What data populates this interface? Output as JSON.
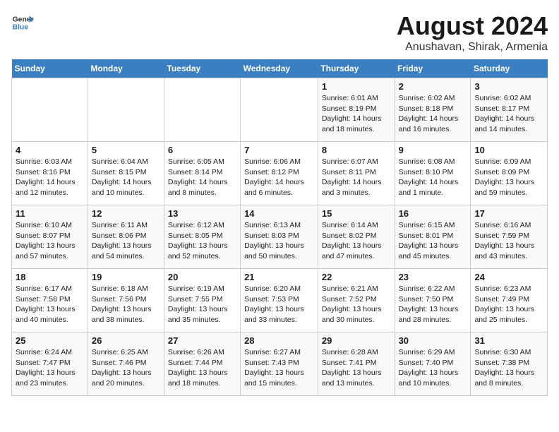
{
  "logo": {
    "line1": "General",
    "line2": "Blue"
  },
  "title": "August 2024",
  "subtitle": "Anushavan, Shirak, Armenia",
  "days_of_week": [
    "Sunday",
    "Monday",
    "Tuesday",
    "Wednesday",
    "Thursday",
    "Friday",
    "Saturday"
  ],
  "weeks": [
    [
      {
        "day": "",
        "info": ""
      },
      {
        "day": "",
        "info": ""
      },
      {
        "day": "",
        "info": ""
      },
      {
        "day": "",
        "info": ""
      },
      {
        "day": "1",
        "info": "Sunrise: 6:01 AM\nSunset: 8:19 PM\nDaylight: 14 hours\nand 18 minutes."
      },
      {
        "day": "2",
        "info": "Sunrise: 6:02 AM\nSunset: 8:18 PM\nDaylight: 14 hours\nand 16 minutes."
      },
      {
        "day": "3",
        "info": "Sunrise: 6:02 AM\nSunset: 8:17 PM\nDaylight: 14 hours\nand 14 minutes."
      }
    ],
    [
      {
        "day": "4",
        "info": "Sunrise: 6:03 AM\nSunset: 8:16 PM\nDaylight: 14 hours\nand 12 minutes."
      },
      {
        "day": "5",
        "info": "Sunrise: 6:04 AM\nSunset: 8:15 PM\nDaylight: 14 hours\nand 10 minutes."
      },
      {
        "day": "6",
        "info": "Sunrise: 6:05 AM\nSunset: 8:14 PM\nDaylight: 14 hours\nand 8 minutes."
      },
      {
        "day": "7",
        "info": "Sunrise: 6:06 AM\nSunset: 8:12 PM\nDaylight: 14 hours\nand 6 minutes."
      },
      {
        "day": "8",
        "info": "Sunrise: 6:07 AM\nSunset: 8:11 PM\nDaylight: 14 hours\nand 3 minutes."
      },
      {
        "day": "9",
        "info": "Sunrise: 6:08 AM\nSunset: 8:10 PM\nDaylight: 14 hours\nand 1 minute."
      },
      {
        "day": "10",
        "info": "Sunrise: 6:09 AM\nSunset: 8:09 PM\nDaylight: 13 hours\nand 59 minutes."
      }
    ],
    [
      {
        "day": "11",
        "info": "Sunrise: 6:10 AM\nSunset: 8:07 PM\nDaylight: 13 hours\nand 57 minutes."
      },
      {
        "day": "12",
        "info": "Sunrise: 6:11 AM\nSunset: 8:06 PM\nDaylight: 13 hours\nand 54 minutes."
      },
      {
        "day": "13",
        "info": "Sunrise: 6:12 AM\nSunset: 8:05 PM\nDaylight: 13 hours\nand 52 minutes."
      },
      {
        "day": "14",
        "info": "Sunrise: 6:13 AM\nSunset: 8:03 PM\nDaylight: 13 hours\nand 50 minutes."
      },
      {
        "day": "15",
        "info": "Sunrise: 6:14 AM\nSunset: 8:02 PM\nDaylight: 13 hours\nand 47 minutes."
      },
      {
        "day": "16",
        "info": "Sunrise: 6:15 AM\nSunset: 8:01 PM\nDaylight: 13 hours\nand 45 minutes."
      },
      {
        "day": "17",
        "info": "Sunrise: 6:16 AM\nSunset: 7:59 PM\nDaylight: 13 hours\nand 43 minutes."
      }
    ],
    [
      {
        "day": "18",
        "info": "Sunrise: 6:17 AM\nSunset: 7:58 PM\nDaylight: 13 hours\nand 40 minutes."
      },
      {
        "day": "19",
        "info": "Sunrise: 6:18 AM\nSunset: 7:56 PM\nDaylight: 13 hours\nand 38 minutes."
      },
      {
        "day": "20",
        "info": "Sunrise: 6:19 AM\nSunset: 7:55 PM\nDaylight: 13 hours\nand 35 minutes."
      },
      {
        "day": "21",
        "info": "Sunrise: 6:20 AM\nSunset: 7:53 PM\nDaylight: 13 hours\nand 33 minutes."
      },
      {
        "day": "22",
        "info": "Sunrise: 6:21 AM\nSunset: 7:52 PM\nDaylight: 13 hours\nand 30 minutes."
      },
      {
        "day": "23",
        "info": "Sunrise: 6:22 AM\nSunset: 7:50 PM\nDaylight: 13 hours\nand 28 minutes."
      },
      {
        "day": "24",
        "info": "Sunrise: 6:23 AM\nSunset: 7:49 PM\nDaylight: 13 hours\nand 25 minutes."
      }
    ],
    [
      {
        "day": "25",
        "info": "Sunrise: 6:24 AM\nSunset: 7:47 PM\nDaylight: 13 hours\nand 23 minutes."
      },
      {
        "day": "26",
        "info": "Sunrise: 6:25 AM\nSunset: 7:46 PM\nDaylight: 13 hours\nand 20 minutes."
      },
      {
        "day": "27",
        "info": "Sunrise: 6:26 AM\nSunset: 7:44 PM\nDaylight: 13 hours\nand 18 minutes."
      },
      {
        "day": "28",
        "info": "Sunrise: 6:27 AM\nSunset: 7:43 PM\nDaylight: 13 hours\nand 15 minutes."
      },
      {
        "day": "29",
        "info": "Sunrise: 6:28 AM\nSunset: 7:41 PM\nDaylight: 13 hours\nand 13 minutes."
      },
      {
        "day": "30",
        "info": "Sunrise: 6:29 AM\nSunset: 7:40 PM\nDaylight: 13 hours\nand 10 minutes."
      },
      {
        "day": "31",
        "info": "Sunrise: 6:30 AM\nSunset: 7:38 PM\nDaylight: 13 hours\nand 8 minutes."
      }
    ]
  ]
}
